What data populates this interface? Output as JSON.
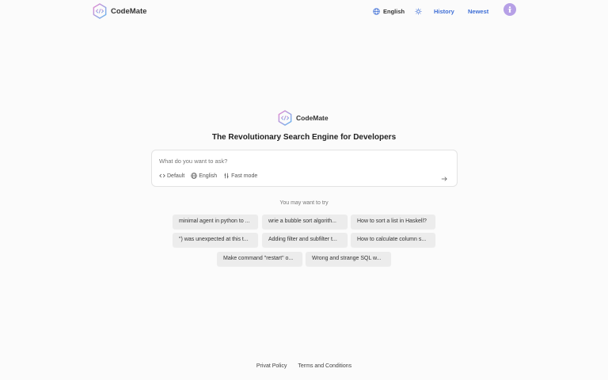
{
  "header": {
    "app_name": "CodeMate",
    "language": "English",
    "history": "History",
    "newest": "Newest"
  },
  "brand": {
    "name": "CodeMate",
    "tagline": "The Revolutionary Search Engine for Developers"
  },
  "search": {
    "placeholder": "What do you want to ask?",
    "value": "",
    "options": {
      "mode": "Default",
      "language": "English",
      "speed": "Fast mode"
    }
  },
  "suggestions": {
    "label": "You may want to try",
    "items": [
      "minimal agent in python to ...",
      "wrie a bubble sort algorith...",
      "How to sort a list in Haskell?",
      "\") was unexpected at this t...",
      "Adding filter and subfilter t...",
      "How to calculate column s...",
      "Make command \"restart\" o...",
      "Wrong and strange SQL w..."
    ]
  },
  "footer": {
    "privacy": "Privat Policy",
    "terms": "Terms and Conditions"
  },
  "colors": {
    "link": "#3e6ed6",
    "avatar": "#b6a0e6",
    "logo_gradient_start": "#e98ad0",
    "logo_gradient_end": "#62b6f0"
  }
}
